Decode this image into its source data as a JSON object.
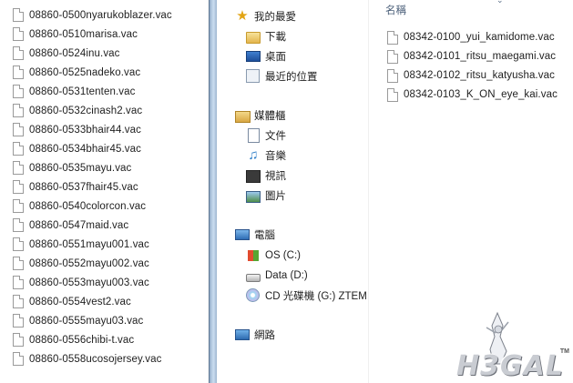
{
  "left_files": [
    "08860-0500nyarukoblazer.vac",
    "08860-0510marisa.vac",
    "08860-0524inu.vac",
    "08860-0525nadeko.vac",
    "08860-0531tenten.vac",
    "08860-0532cinash2.vac",
    "08860-0533bhair44.vac",
    "08860-0534bhair45.vac",
    "08860-0535mayu.vac",
    "08860-0537fhair45.vac",
    "08860-0540colorcon.vac",
    "08860-0547maid.vac",
    "08860-0551mayu001.vac",
    "08860-0552mayu002.vac",
    "08860-0553mayu003.vac",
    "08860-0554vest2.vac",
    "08860-0555mayu03.vac",
    "08860-0556chibi-t.vac",
    "08860-0558ucosojersey.vac"
  ],
  "nav": {
    "favorites": {
      "label": "我的最愛",
      "icon": "star-icon"
    },
    "downloads": {
      "label": "下載",
      "icon": "folder-icon"
    },
    "desktop": {
      "label": "桌面",
      "icon": "desktop-icon"
    },
    "recent": {
      "label": "最近的位置",
      "icon": "recent-places-icon"
    },
    "libraries": {
      "label": "媒體櫃",
      "icon": "library-icon"
    },
    "documents": {
      "label": "文件",
      "icon": "document-icon"
    },
    "music": {
      "label": "音樂",
      "icon": "music-icon"
    },
    "videos": {
      "label": "視訊",
      "icon": "video-icon"
    },
    "pictures": {
      "label": "圖片",
      "icon": "picture-icon"
    },
    "computer": {
      "label": "電腦",
      "icon": "computer-icon"
    },
    "drive_c": {
      "label": "OS (C:)",
      "icon": "windows-drive-icon"
    },
    "drive_d": {
      "label": "Data (D:)",
      "icon": "hard-drive-icon"
    },
    "drive_g": {
      "label": "CD 光碟機 (G:) ZTEM",
      "icon": "cd-drive-icon"
    },
    "network": {
      "label": "網路",
      "icon": "network-icon"
    }
  },
  "content": {
    "column_header": "名稱",
    "files": [
      "08342-0100_yui_kamidome.vac",
      "08342-0101_ritsu_maegami.vac",
      "08342-0102_ritsu_katyusha.vac",
      "08342-0103_K_ON_eye_kai.vac"
    ]
  },
  "watermark": {
    "logo": "H3GAL",
    "tm": "TM"
  }
}
